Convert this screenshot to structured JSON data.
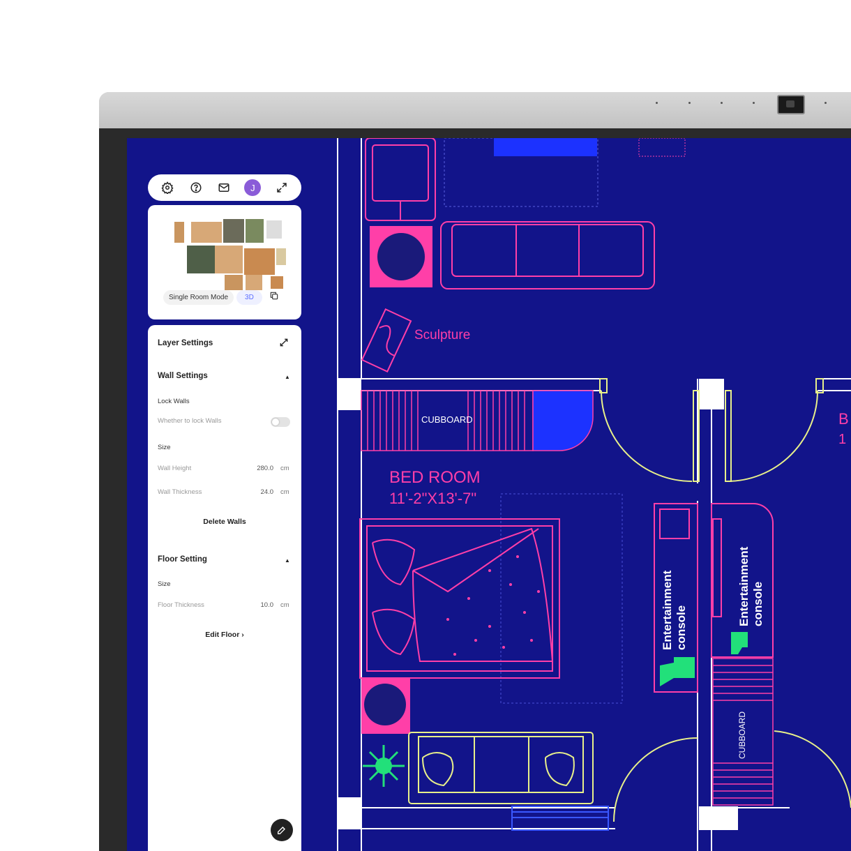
{
  "toolbar": {
    "icons": [
      "settings-icon",
      "help-icon",
      "mail-icon",
      "avatar",
      "fullscreen-icon"
    ],
    "avatar_initial": "J"
  },
  "minimap": {
    "mode_label": "Single Room Mode",
    "view_label": "3D"
  },
  "layer_settings": {
    "title": "Layer Settings",
    "wall_settings": {
      "title": "Wall Settings",
      "lock_walls_label": "Lock Walls",
      "lock_walls_description": "Whether to lock Walls",
      "lock_walls_on": false,
      "size_label": "Size",
      "wall_height_label": "Wall Height",
      "wall_height_value": "280.0",
      "wall_thickness_label": "Wall Thickness",
      "wall_thickness_value": "24.0",
      "unit": "cm",
      "delete_label": "Delete Walls"
    },
    "floor_setting": {
      "title": "Floor Setting",
      "size_label": "Size",
      "floor_thickness_label": "Floor Thickness",
      "floor_thickness_value": "10.0",
      "unit": "cm",
      "edit_label": "Edit Floor"
    }
  },
  "plan": {
    "sculpture_label": "Sculpture",
    "cubboard_label": "CUBBOARD",
    "room_name": "BED ROOM",
    "room_size": "11'-2\"X13'-7\"",
    "entertainment_label_1": "Entertainment",
    "console_label_1": "console",
    "entertainment_label_2": "Entertainment",
    "console_label_2": "console",
    "cubboard_label_2": "CUBBOARD",
    "partial_label_1": "B",
    "partial_label_2": "1"
  },
  "colors": {
    "screen_bg": "#12148a",
    "wall": "#ffffff",
    "furniture_pink": "#ff3fa8",
    "door_yellow": "#e8f08a",
    "accent_green": "#22e07a"
  }
}
